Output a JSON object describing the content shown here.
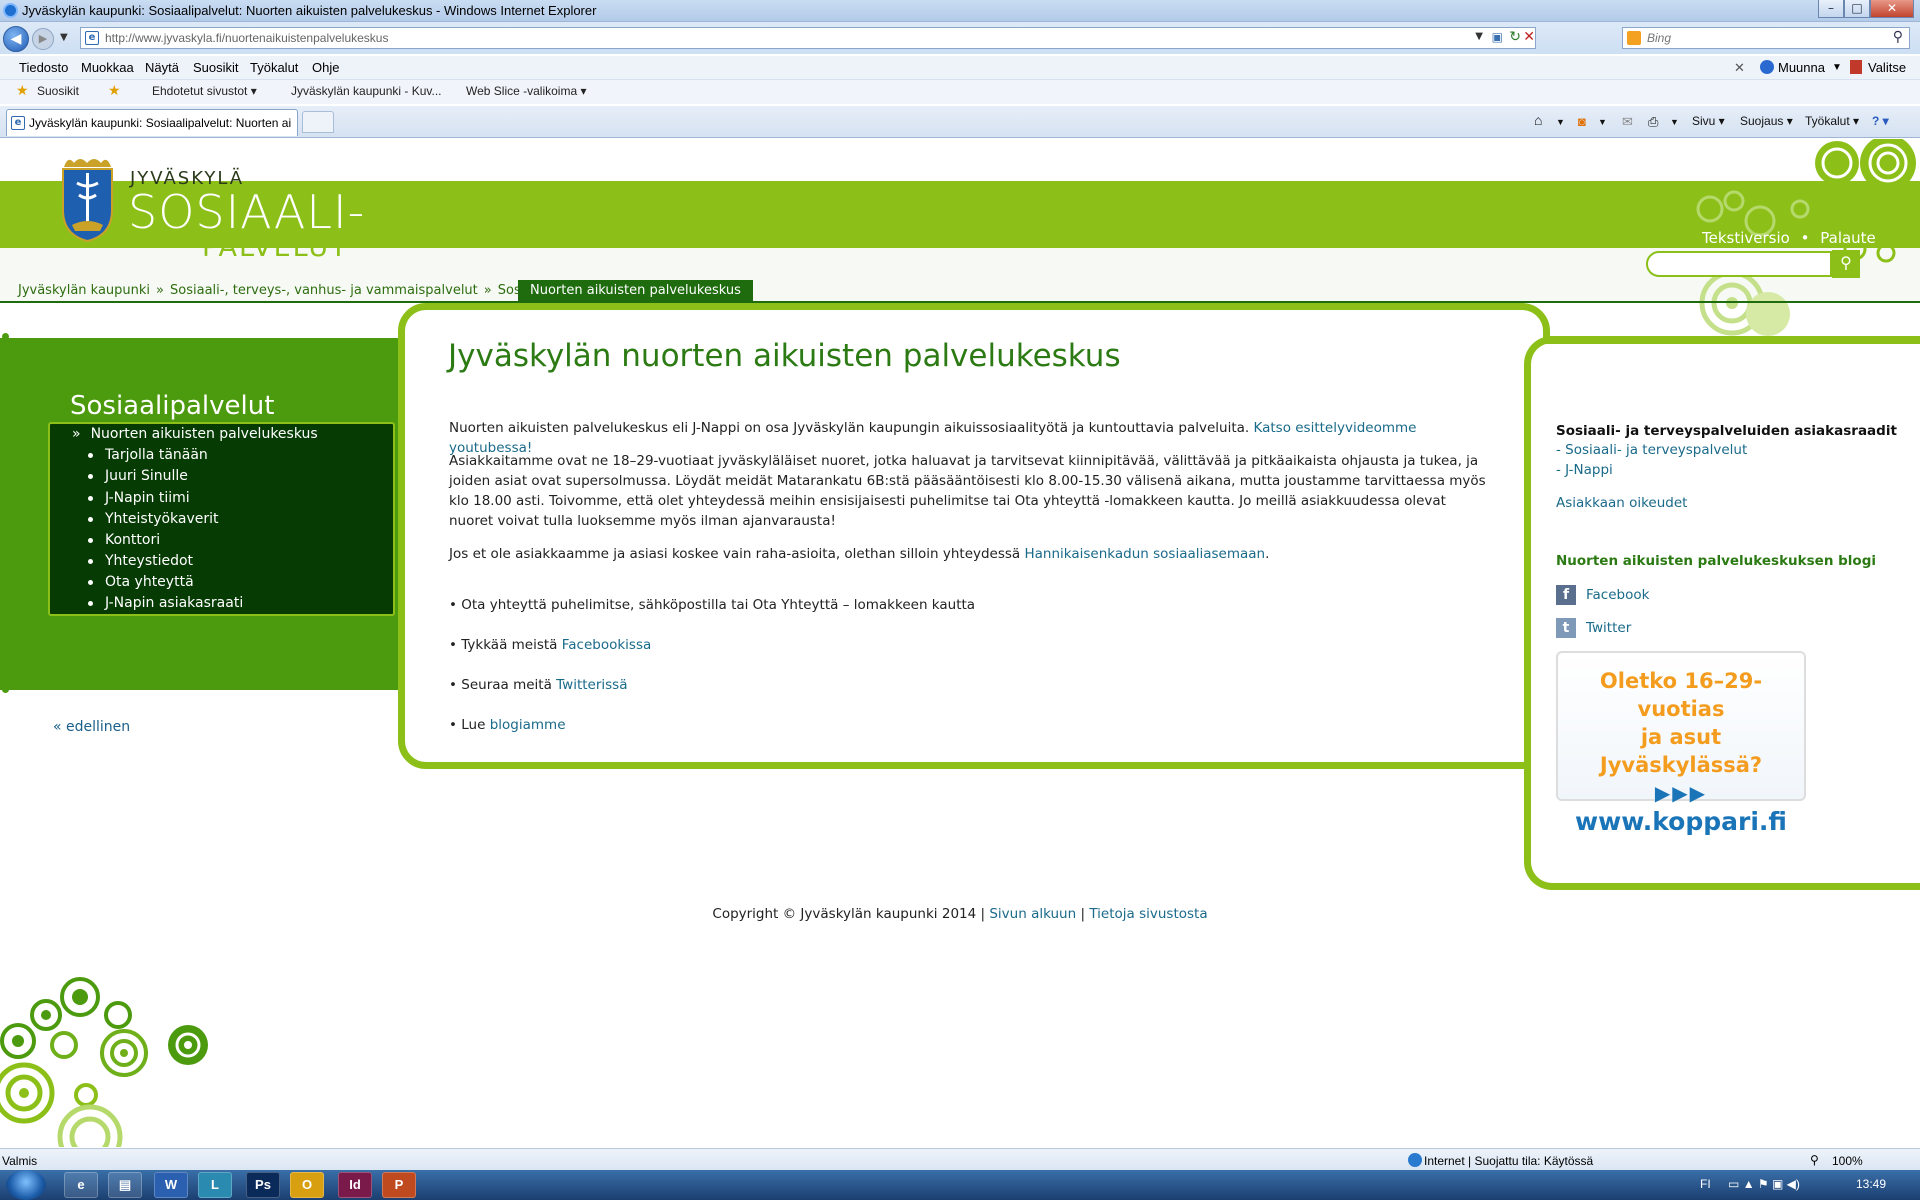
{
  "window": {
    "title": "Jyväskylän kaupunki: Sosiaalipalvelut: Nuorten aikuisten palvelukeskus - Windows Internet Explorer",
    "min": "–",
    "max": "□",
    "close": "✕"
  },
  "addressbar": {
    "url": "http://www.jyvaskyla.fi/nuortenaikuistenpalvelukeskus",
    "search_placeholder": "Bing"
  },
  "menu": [
    "Tiedosto",
    "Muokkaa",
    "Näytä",
    "Suosikit",
    "Työkalut",
    "Ohje"
  ],
  "menu_right": {
    "convert": "Muunna",
    "select": "Valitse"
  },
  "favorites": {
    "label": "Suosikit",
    "items": [
      "Ehdotetut sivustot ▾",
      "Jyväskylän kaupunki - Kuv...",
      "Web Slice -valikoima ▾"
    ]
  },
  "tab": {
    "label": "Jyväskylän kaupunki: Sosiaalipalvelut: Nuorten ai..."
  },
  "commandbar": {
    "page": "Sivu ▾",
    "safety": "Suojaus ▾",
    "tools": "Työkalut ▾",
    "help": "? ▾"
  },
  "site": {
    "brand_city": "JYVÄSKYLÄ",
    "brand_main": "SOSIAALI-",
    "brand_sub": "PALVELUT",
    "text_version": "Tekstiversio",
    "feedback": "Palaute",
    "link_sep": "•"
  },
  "breadcrumbs": {
    "items": [
      "Jyväskylän kaupunki",
      "Sosiaali-, terveys-, vanhus- ja vammaispalvelut",
      "Sosiaalipalvelut"
    ],
    "sep": "»",
    "active": "Nuorten aikuisten palvelukeskus"
  },
  "leftnav": {
    "title": "Sosiaalipalvelut",
    "marker": "»",
    "selected": "Nuorten aikuisten palvelukeskus",
    "items": [
      "Tarjolla tänään",
      "Juuri Sinulle",
      "J-Napin tiimi",
      "Yhteistyökaverit",
      "Konttori",
      "Yhteystiedot",
      "Ota yhteyttä",
      "J-Napin asiakasraati"
    ],
    "prev": "« edellinen"
  },
  "main": {
    "title": "Jyväskylän nuorten aikuisten palvelukeskus",
    "p1_text": "Nuorten aikuisten palvelukeskus eli J-Nappi on osa Jyväskylän kaupungin aikuissosiaalityötä ja kuntouttavia palveluita.",
    "p1_link": "Katso esittelyvideomme youtubessa!",
    "p2": "Asiakkaitamme ovat ne 18–29-vuotiaat jyväskyläläiset nuoret, jotka haluavat ja tarvitsevat kiinnipitävää, välittävää ja pitkäaikaista ohjausta ja tukea, ja joiden asiat ovat supersolmussa. Löydät meidät Matarankatu 6B:stä pääsääntöisesti klo 8.00-15.30 välisenä aikana, mutta joustamme tarvittaessa myös klo 18.00 asti. Toivomme, että olet yhteydessä meihin ensisijaisesti puhelimitse tai Ota yhteyttä -lomakkeen kautta. Jo meillä asiakkuudessa olevat nuoret voivat tulla luoksemme myös ilman ajanvarausta!",
    "p3_text": "Jos et ole asiakkaamme ja asiasi koskee vain raha-asioita, olethan silloin yhteydessä",
    "p3_link": "Hannikaisenkadun sosiaaliasemaan",
    "p3_end": ".",
    "bullet": "•",
    "b1": "Ota yhteyttä puhelimitse, sähköpostilla tai Ota Yhteyttä – lomakkeen kautta",
    "b2_text": "Tykkää meistä",
    "b2_link": "Facebookissa",
    "b3_text": "Seuraa meitä",
    "b3_link": "Twitterissä",
    "b4_text": "Lue",
    "b4_link": "blogiamme"
  },
  "right": {
    "heading1": "Sosiaali- ja terveyspalveluiden asiakasraadit",
    "link1": "- Sosiaali- ja terveyspalvelut",
    "link2": "- J-Nappi",
    "link3": "Asiakkaan oikeudet",
    "heading2": "Nuorten aikuisten palvelukeskuksen blogi",
    "facebook": "Facebook",
    "twitter": "Twitter",
    "ad_line1": "Oletko 16–29-vuotias",
    "ad_line2": "ja asut Jyväskylässä?",
    "ad_arrows": "▶▶▶",
    "ad_url": "www.koppari.fi"
  },
  "footer": {
    "copyright": "Copyright © Jyväskylän kaupunki 2014 |",
    "top": "Sivun alkuun",
    "sep": "|",
    "about": "Tietoja sivustosta"
  },
  "statusbar": {
    "left": "Valmis",
    "zone": "Internet | Suojattu tila: Käytössä",
    "zoom": "100%"
  },
  "taskbar": {
    "lang": "FI",
    "time": "13:49",
    "apps": [
      "e",
      "▤",
      "W",
      "L",
      "Ps",
      "O",
      "Id",
      "P"
    ]
  },
  "colors": {
    "brand_green": "#8cc019",
    "dark_green": "#1f6c0e",
    "nav_bg": "#063c04",
    "link": "#1a6a8a"
  }
}
